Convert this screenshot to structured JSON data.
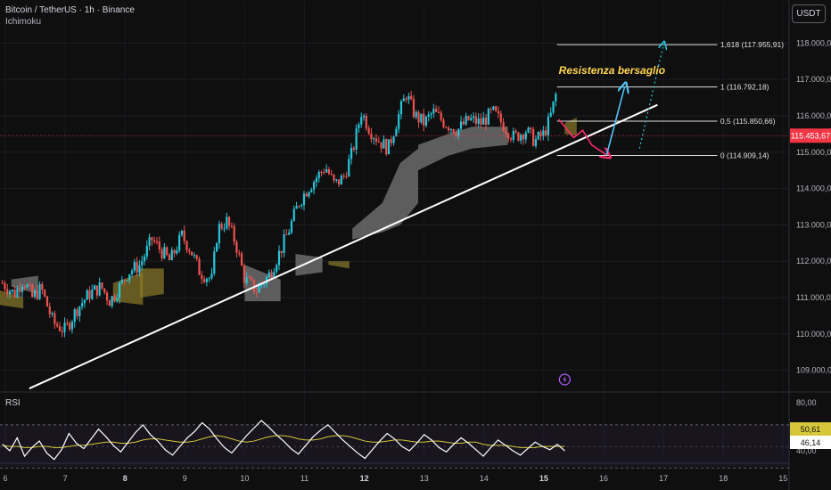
{
  "header": {
    "title": "Bitcoin / TetherUS · 1h · Binance",
    "indicator": "Ichimoku",
    "currency": "USDT"
  },
  "colors": {
    "background": "#0f0f0f",
    "up": "#26c6da",
    "down": "#ef5350",
    "cloud_bull": "#787878",
    "cloud_bear": "#8a7a2a",
    "trendline": "#ffffff",
    "rsi": "#ffffff",
    "rsi_ma": "#d6c73a",
    "projection_up": "#4fc3f7",
    "projection_down": "#ff2d6f",
    "annotation": "#ffd54f",
    "price_label": "#f23645"
  },
  "chart_data": {
    "type": "candlestick",
    "symbol": "Bitcoin / TetherUS",
    "interval": "1h",
    "exchange": "Binance",
    "x_ticks": [
      "6",
      "7",
      "8",
      "9",
      "10",
      "11",
      "12",
      "13",
      "14",
      "15",
      "16",
      "17",
      "18",
      "15"
    ],
    "y_ticks": [
      "118.000,00",
      "117.000,00",
      "116.000,00",
      "115.000,00",
      "114.000,00",
      "113.000,00",
      "112.000,00",
      "111.000,00",
      "110.000,00",
      "109.000,00"
    ],
    "ylim": [
      108600,
      118400
    ],
    "current_price": "115.453,67",
    "annotation": "Resistenza bersaglio",
    "fib_levels": [
      {
        "ratio": "1,618",
        "label": "1,618 (117.955,91)",
        "price": 117955.91
      },
      {
        "ratio": "1",
        "label": "1 (116.792,18)",
        "price": 116792.18
      },
      {
        "ratio": "0,5",
        "label": "0,5 (115.850,66)",
        "price": 115850.66
      },
      {
        "ratio": "0",
        "label": "0 (114.909,14)",
        "price": 114909.14
      }
    ],
    "trendline": [
      {
        "x": 6.4,
        "y": 108500
      },
      {
        "x": 16.9,
        "y": 116300
      }
    ],
    "projection_down": [
      {
        "x": 15.25,
        "y": 115900
      },
      {
        "x": 15.5,
        "y": 115400
      },
      {
        "x": 15.65,
        "y": 115600
      },
      {
        "x": 15.8,
        "y": 115200
      },
      {
        "x": 16.05,
        "y": 114920
      }
    ],
    "projection_up": [
      {
        "x": 16.05,
        "y": 114920
      },
      {
        "x": 16.35,
        "y": 116790
      }
    ],
    "projection_dotted": [
      {
        "x": 16.6,
        "y": 115100
      },
      {
        "x": 17.0,
        "y": 117950
      }
    ],
    "price_path": [
      {
        "x": 5.95,
        "y": 111400
      },
      {
        "x": 6.15,
        "y": 111100
      },
      {
        "x": 6.3,
        "y": 111500
      },
      {
        "x": 6.45,
        "y": 111000
      },
      {
        "x": 6.6,
        "y": 111250
      },
      {
        "x": 6.8,
        "y": 110300
      },
      {
        "x": 7.0,
        "y": 110100
      },
      {
        "x": 7.2,
        "y": 110700
      },
      {
        "x": 7.4,
        "y": 111100
      },
      {
        "x": 7.6,
        "y": 111300
      },
      {
        "x": 7.75,
        "y": 110900
      },
      {
        "x": 7.95,
        "y": 111400
      },
      {
        "x": 8.05,
        "y": 111700
      },
      {
        "x": 8.25,
        "y": 111900
      },
      {
        "x": 8.45,
        "y": 112600
      },
      {
        "x": 8.6,
        "y": 112300
      },
      {
        "x": 8.75,
        "y": 112000
      },
      {
        "x": 8.95,
        "y": 112700
      },
      {
        "x": 9.1,
        "y": 112300
      },
      {
        "x": 9.25,
        "y": 111700
      },
      {
        "x": 9.45,
        "y": 111500
      },
      {
        "x": 9.55,
        "y": 112900
      },
      {
        "x": 9.7,
        "y": 113100
      },
      {
        "x": 9.85,
        "y": 112500
      },
      {
        "x": 10.0,
        "y": 111500
      },
      {
        "x": 10.2,
        "y": 111200
      },
      {
        "x": 10.4,
        "y": 111600
      },
      {
        "x": 10.6,
        "y": 112300
      },
      {
        "x": 10.75,
        "y": 112900
      },
      {
        "x": 10.9,
        "y": 113600
      },
      {
        "x": 11.05,
        "y": 114000
      },
      {
        "x": 11.2,
        "y": 114300
      },
      {
        "x": 11.35,
        "y": 114600
      },
      {
        "x": 11.5,
        "y": 114100
      },
      {
        "x": 11.65,
        "y": 114300
      },
      {
        "x": 11.8,
        "y": 115000
      },
      {
        "x": 11.95,
        "y": 116100
      },
      {
        "x": 12.1,
        "y": 115600
      },
      {
        "x": 12.25,
        "y": 115300
      },
      {
        "x": 12.4,
        "y": 115100
      },
      {
        "x": 12.55,
        "y": 115900
      },
      {
        "x": 12.7,
        "y": 116600
      },
      {
        "x": 12.85,
        "y": 116000
      },
      {
        "x": 13.0,
        "y": 115800
      },
      {
        "x": 13.15,
        "y": 116100
      },
      {
        "x": 13.35,
        "y": 115800
      },
      {
        "x": 13.55,
        "y": 115600
      },
      {
        "x": 13.75,
        "y": 115900
      },
      {
        "x": 13.95,
        "y": 115800
      },
      {
        "x": 14.15,
        "y": 116100
      },
      {
        "x": 14.35,
        "y": 115700
      },
      {
        "x": 14.5,
        "y": 115400
      },
      {
        "x": 14.7,
        "y": 115600
      },
      {
        "x": 14.85,
        "y": 115300
      },
      {
        "x": 15.0,
        "y": 115500
      },
      {
        "x": 15.1,
        "y": 115900
      },
      {
        "x": 15.22,
        "y": 116700
      }
    ],
    "cloud_polygons": [
      {
        "kind": "bull",
        "points": [
          [
            10.85,
            112200
          ],
          [
            11.3,
            112100
          ],
          [
            11.3,
            111700
          ],
          [
            10.85,
            111600
          ]
        ]
      },
      {
        "kind": "bull",
        "points": [
          [
            10.0,
            111900
          ],
          [
            10.6,
            111500
          ],
          [
            10.6,
            110900
          ],
          [
            10.0,
            110900
          ]
        ]
      },
      {
        "kind": "bull",
        "points": [
          [
            6.1,
            111500
          ],
          [
            6.55,
            111600
          ],
          [
            6.55,
            111100
          ],
          [
            6.1,
            111300
          ]
        ]
      },
      {
        "kind": "bear",
        "points": [
          [
            5.9,
            111200
          ],
          [
            6.3,
            111000
          ],
          [
            6.3,
            110700
          ],
          [
            5.9,
            110800
          ]
        ]
      },
      {
        "kind": "bear",
        "points": [
          [
            7.8,
            111400
          ],
          [
            8.3,
            111700
          ],
          [
            8.3,
            110800
          ],
          [
            7.8,
            110900
          ]
        ]
      },
      {
        "kind": "bear",
        "points": [
          [
            8.25,
            111800
          ],
          [
            8.65,
            111800
          ],
          [
            8.65,
            111100
          ],
          [
            8.25,
            111000
          ]
        ]
      },
      {
        "kind": "bull",
        "points": [
          [
            11.8,
            112900
          ],
          [
            12.3,
            113600
          ],
          [
            12.6,
            114700
          ],
          [
            12.9,
            115100
          ],
          [
            12.9,
            113600
          ],
          [
            12.6,
            113000
          ],
          [
            12.3,
            112800
          ],
          [
            11.8,
            112600
          ]
        ]
      },
      {
        "kind": "bull",
        "points": [
          [
            12.9,
            115200
          ],
          [
            13.4,
            115500
          ],
          [
            13.8,
            115700
          ],
          [
            14.4,
            115700
          ],
          [
            14.4,
            115200
          ],
          [
            13.8,
            115100
          ],
          [
            13.4,
            114900
          ],
          [
            12.9,
            114500
          ]
        ]
      },
      {
        "kind": "bear",
        "points": [
          [
            11.4,
            112000
          ],
          [
            11.75,
            112000
          ],
          [
            11.75,
            111800
          ],
          [
            11.4,
            111900
          ]
        ]
      },
      {
        "kind": "bear",
        "points": [
          [
            15.35,
            115800
          ],
          [
            15.55,
            115950
          ],
          [
            15.55,
            115450
          ],
          [
            15.35,
            115500
          ]
        ]
      }
    ],
    "rsi": {
      "label": "RSI",
      "ticks": [
        "80,00",
        "40,00"
      ],
      "ylim": [
        32,
        88
      ],
      "band": [
        30,
        70
      ],
      "rsi_value": "46,14",
      "ma_value": "50,61",
      "values": [
        52,
        46,
        58,
        41,
        49,
        55,
        44,
        38,
        47,
        62,
        53,
        48,
        57,
        66,
        59,
        51,
        45,
        54,
        63,
        70,
        61,
        55,
        47,
        42,
        50,
        58,
        64,
        72,
        66,
        57,
        49,
        44,
        52,
        60,
        67,
        74,
        68,
        61,
        55,
        48,
        43,
        51,
        59,
        65,
        70,
        63,
        56,
        50,
        44,
        39,
        47,
        55,
        62,
        57,
        50,
        46,
        53,
        61,
        56,
        49,
        45,
        52,
        58,
        53,
        47,
        41,
        49,
        56,
        51,
        46,
        42,
        48,
        54,
        50,
        47,
        52,
        46
      ],
      "ma": [
        51,
        50,
        50,
        49,
        49,
        50,
        50,
        49,
        49,
        50,
        51,
        51,
        52,
        53,
        54,
        54,
        53,
        53,
        54,
        56,
        57,
        57,
        56,
        55,
        54,
        54,
        55,
        57,
        59,
        60,
        59,
        57,
        55,
        54,
        55,
        57,
        59,
        60,
        60,
        59,
        57,
        56,
        56,
        57,
        59,
        60,
        60,
        59,
        57,
        55,
        54,
        54,
        55,
        56,
        56,
        55,
        54,
        54,
        55,
        55,
        54,
        53,
        53,
        54,
        54,
        52,
        51,
        51,
        51,
        50,
        49,
        49,
        49,
        50,
        50,
        50,
        50
      ]
    }
  }
}
